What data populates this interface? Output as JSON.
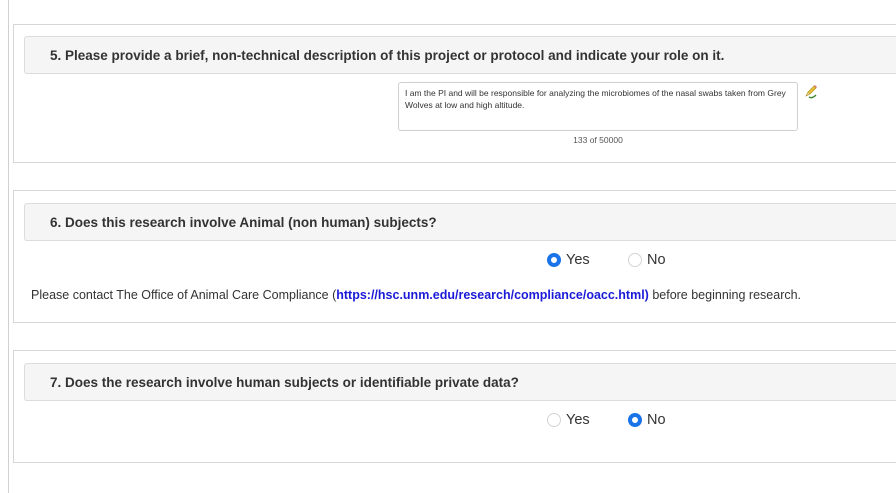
{
  "q5": {
    "title": "5. Please provide a brief, non-technical description of this project or protocol and indicate your role on it.",
    "answer": "I am the PI and will be responsible for analyzing the microbiomes of the nasal swabs taken from Grey Wolves at low and high altitude.",
    "char_count": "133 of 50000",
    "edit_icon": "pencil-edit-icon"
  },
  "q6": {
    "title": "6. Does this research involve Animal (non human) subjects?",
    "yes_label": "Yes",
    "no_label": "No",
    "selected": "Yes",
    "note_prefix": "Please contact The Office of Animal Care Compliance (",
    "note_link": "https://hsc.unm.edu/research/compliance/oacc.html)",
    "note_suffix": " before beginning research."
  },
  "q7": {
    "title": "7. Does the research involve human subjects or identifiable private data?",
    "yes_label": "Yes",
    "no_label": "No",
    "selected": "No"
  },
  "colors": {
    "accent": "#1a73e8",
    "link": "#1a1ad8",
    "header_bg": "#f5f5f5"
  }
}
